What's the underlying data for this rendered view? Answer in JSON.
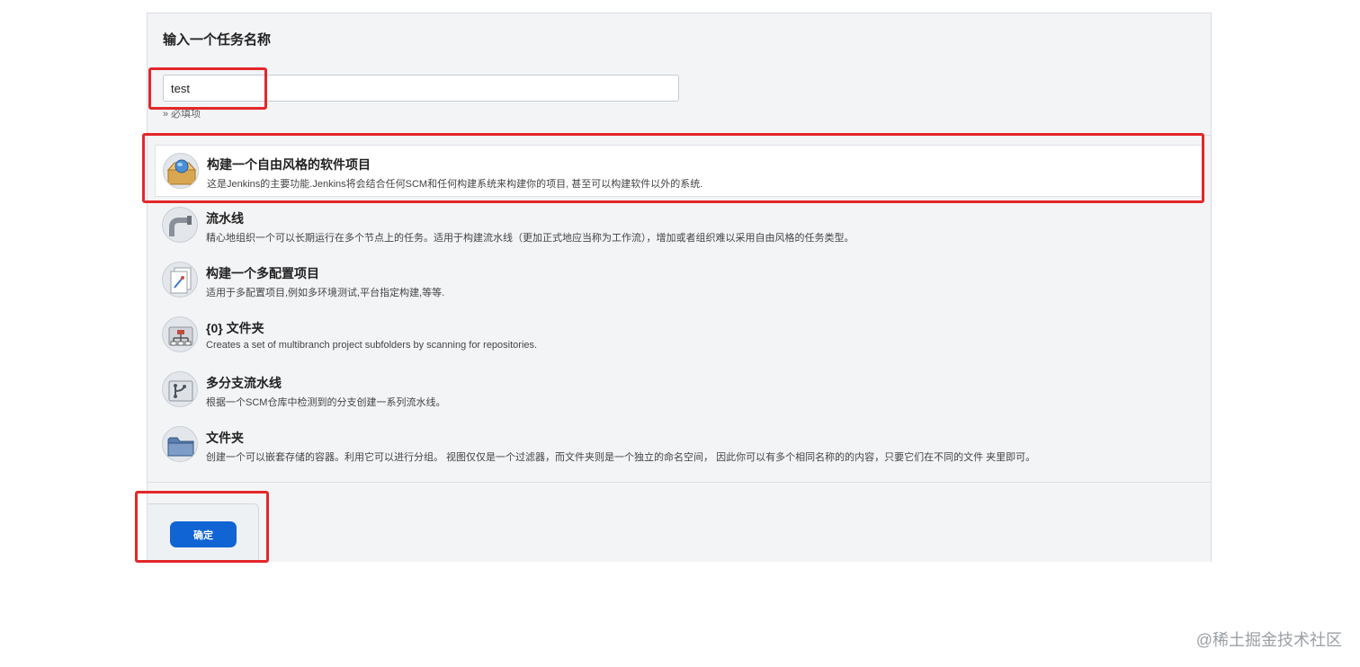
{
  "name_section": {
    "title": "输入一个任务名称",
    "input_value": "test",
    "required_hint": "» 必填项"
  },
  "item_types": [
    {
      "label": "构建一个自由风格的软件项目",
      "description": "这是Jenkins的主要功能.Jenkins将会结合任何SCM和任何构建系统来构建你的项目, 甚至可以构建软件以外的系统.",
      "icon": "freestyle-project-icon",
      "selected": true
    },
    {
      "label": "流水线",
      "description": "精心地组织一个可以长期运行在多个节点上的任务。适用于构建流水线（更加正式地应当称为工作流），增加或者组织难以采用自由风格的任务类型。",
      "icon": "pipeline-icon",
      "selected": false
    },
    {
      "label": "构建一个多配置项目",
      "description": "适用于多配置项目,例如多环境测试,平台指定构建,等等.",
      "icon": "multi-config-project-icon",
      "selected": false
    },
    {
      "label": "{0} 文件夹",
      "description": "Creates a set of multibranch project subfolders by scanning for repositories.",
      "icon": "organization-folder-icon",
      "selected": false
    },
    {
      "label": "多分支流水线",
      "description": "根据一个SCM仓库中检测到的分支创建一系列流水线。",
      "icon": "multibranch-pipeline-icon",
      "selected": false
    },
    {
      "label": "文件夹",
      "description": "创建一个可以嵌套存储的容器。利用它可以进行分组。 视图仅仅是一个过滤器，而文件夹则是一个独立的命名空间， 因此你可以有多个相同名称的的内容，只要它们在不同的文件 夹里即可。",
      "icon": "folder-icon",
      "selected": false
    }
  ],
  "footer": {
    "ok_label": "确定"
  },
  "watermark": "@稀土掘金技术社区",
  "colors": {
    "accent_blue": "#1064d4",
    "highlight_red": "#e3272a"
  }
}
